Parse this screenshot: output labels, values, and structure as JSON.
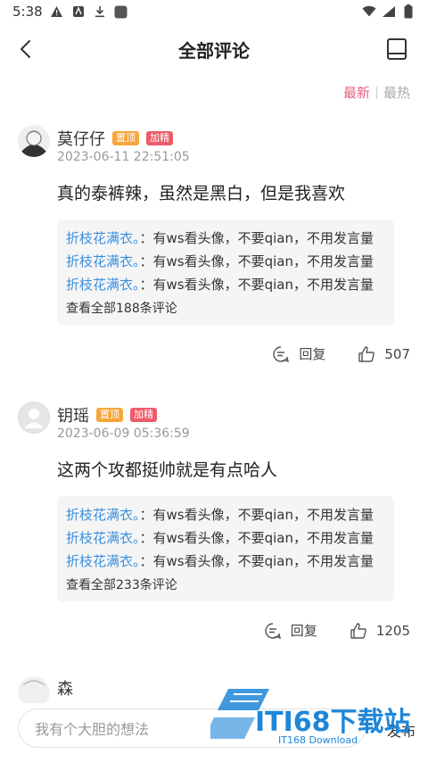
{
  "status_bar": {
    "time": "5:38"
  },
  "header": {
    "title": "全部评论"
  },
  "sort": {
    "latest": "最新",
    "hot": "最热"
  },
  "comments": [
    {
      "name": "莫仔仔",
      "tag_top": "置顶",
      "tag_fine": "加精",
      "time": "2023-06-11 22:51:05",
      "text": "真的泰裤辣，虽然是黑白，但是我喜欢",
      "replies": [
        {
          "user": "折枝花满衣。",
          "content": "：有ws看头像，不要qian，不用发言量"
        },
        {
          "user": "折枝花满衣。",
          "content": "：有ws看头像，不要qian，不用发言量"
        },
        {
          "user": "折枝花满衣。",
          "content": "：有ws看头像，不要qian，不用发言量"
        }
      ],
      "view_all": "查看全部188条评论",
      "reply_label": "回复",
      "likes": "507"
    },
    {
      "name": "钥瑶",
      "tag_top": "置顶",
      "tag_fine": "加精",
      "time": "2023-06-09 05:36:59",
      "text": "这两个攻都挺帅就是有点哈人",
      "replies": [
        {
          "user": "折枝花满衣。",
          "content": "：有ws看头像，不要qian，不用发言量"
        },
        {
          "user": "折枝花满衣。",
          "content": "：有ws看头像，不要qian，不用发言量"
        },
        {
          "user": "折枝花满衣。",
          "content": "：有ws看头像，不要qian，不用发言量"
        }
      ],
      "view_all": "查看全部233条评论",
      "reply_label": "回复",
      "likes": "1205"
    },
    {
      "name": "森"
    }
  ],
  "input": {
    "placeholder": "我有个大胆的想法",
    "send": "发布"
  },
  "watermark": {
    "text": "ITI68下载站",
    "sub": "IT168 Download"
  }
}
